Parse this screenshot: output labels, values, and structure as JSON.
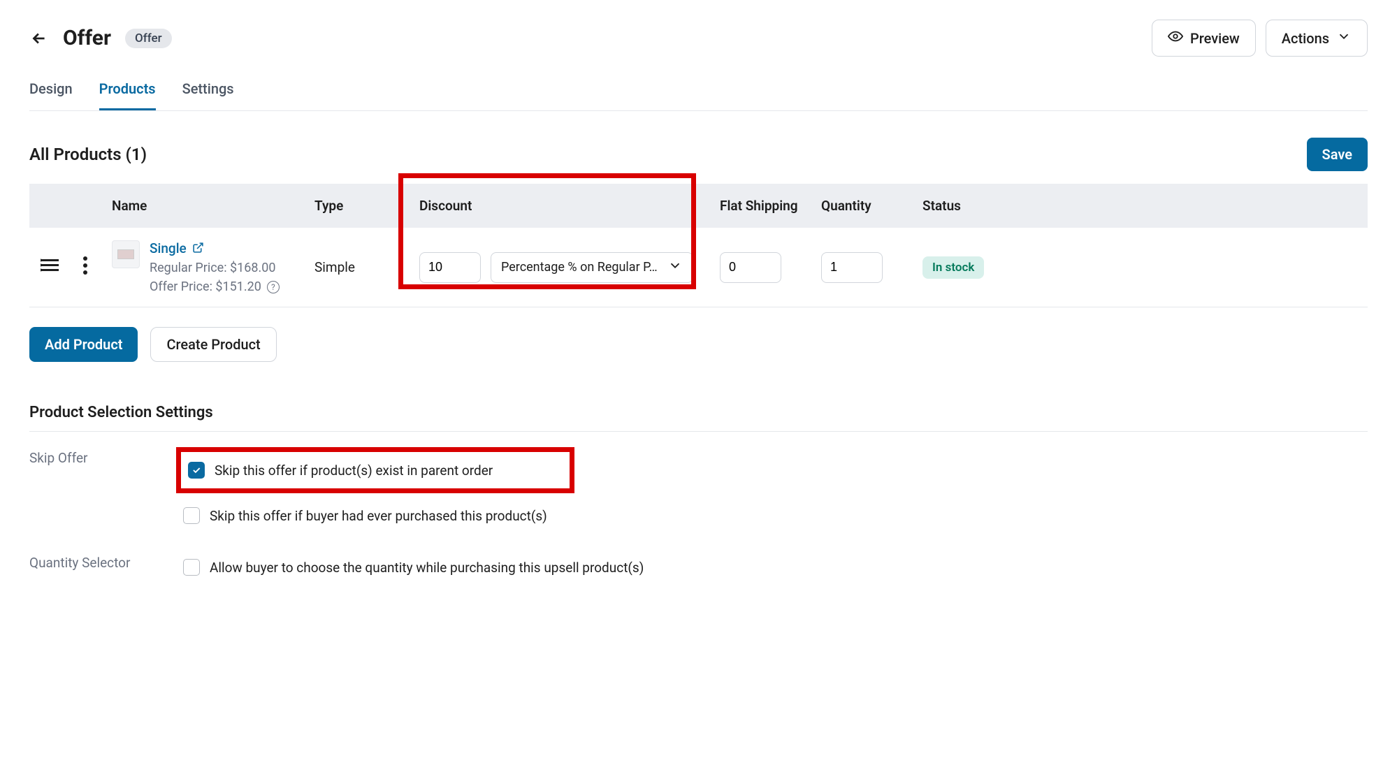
{
  "header": {
    "title": "Offer",
    "badge": "Offer",
    "preview_label": "Preview",
    "actions_label": "Actions"
  },
  "tabs": {
    "design": "Design",
    "products": "Products",
    "settings": "Settings"
  },
  "products": {
    "section_title": "All Products (1)",
    "save_label": "Save",
    "columns": {
      "name": "Name",
      "type": "Type",
      "discount": "Discount",
      "flat_shipping": "Flat Shipping",
      "quantity": "Quantity",
      "status": "Status"
    },
    "row": {
      "name": "Single",
      "regular_price": "Regular Price: $168.00",
      "offer_price": "Offer Price: $151.20",
      "type": "Simple",
      "discount_value": "10",
      "discount_type": "Percentage % on Regular P…",
      "flat_shipping": "0",
      "quantity": "1",
      "status": "In stock"
    },
    "add_product": "Add Product",
    "create_product": "Create Product"
  },
  "selection_settings": {
    "title": "Product Selection Settings",
    "skip_offer_label": "Skip Offer",
    "skip_parent": "Skip this offer if product(s) exist in parent order",
    "skip_purchased": "Skip this offer if buyer had ever purchased this product(s)",
    "quantity_selector_label": "Quantity Selector",
    "quantity_selector_text": "Allow buyer to choose the quantity while purchasing this upsell product(s)"
  }
}
